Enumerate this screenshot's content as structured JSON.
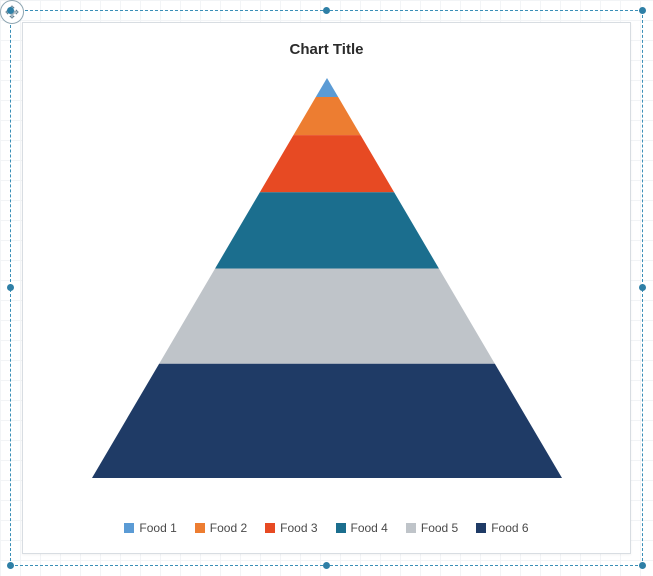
{
  "chart_data": {
    "type": "pyramid",
    "title": "Chart Title",
    "series": [
      {
        "name": "Food 1",
        "value": 1,
        "color": "#5B9BD5"
      },
      {
        "name": "Food 2",
        "value": 2,
        "color": "#ED7D31"
      },
      {
        "name": "Food 3",
        "value": 3,
        "color": "#E74A23"
      },
      {
        "name": "Food 4",
        "value": 4,
        "color": "#1B6E8E"
      },
      {
        "name": "Food 5",
        "value": 5,
        "color": "#BFC4C9"
      },
      {
        "name": "Food 6",
        "value": 6,
        "color": "#1F3B66"
      }
    ]
  }
}
